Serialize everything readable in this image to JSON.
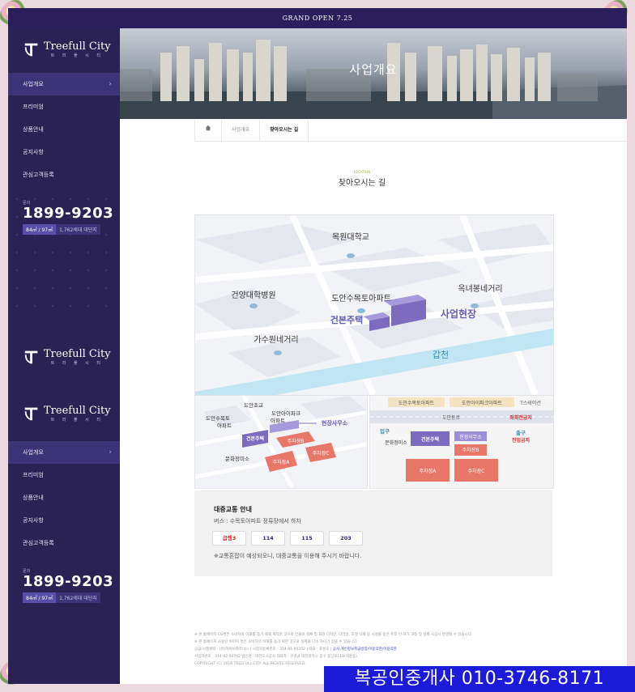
{
  "banner": {
    "text": "GRAND OPEN 7.25"
  },
  "logo": {
    "name": "Treefull City",
    "sub": "트 리 풀 시 티"
  },
  "nav": [
    {
      "label": "사업개요",
      "active": true
    },
    {
      "label": "프리미엄",
      "active": false
    },
    {
      "label": "상품안내",
      "active": false
    },
    {
      "label": "공지사항",
      "active": false
    },
    {
      "label": "관심고객등록",
      "active": false
    }
  ],
  "call": {
    "tag": "문의",
    "number": "1899-9203",
    "badge_size": "84㎡ / 97㎡",
    "badge_units": "1,762세대 대단지"
  },
  "hero": {
    "title": "사업개요"
  },
  "breadcrumb": {
    "home_icon": "home-icon",
    "level1": "사업개요",
    "current": "찾아오시는 길"
  },
  "section": {
    "tag": "LOCATION",
    "title": "찾아오시는 길"
  },
  "map_main": {
    "labels": {
      "university": "목원대학교",
      "hospital": "건양대학병원",
      "apartment": "도안수목토아파트",
      "okbong": "옥녀봉네거리",
      "site": "사업현장",
      "gunbon": "건본주택",
      "gasuwon": "가수원네거리",
      "river": "갑천"
    }
  },
  "map_left": {
    "labels": {
      "doan_school": "도안초교",
      "doan_sumoktow": "도안수목토",
      "apt1": "아파트",
      "doan_ipark": "도안아이파크",
      "apt2": "아파트",
      "field_office": "현장사무소",
      "gunbon": "건본주택",
      "parking_b": "주차장B",
      "munhwa": "문화정미소",
      "parking_a": "주차장A",
      "parking_c": "주차장C"
    }
  },
  "map_right": {
    "labels": {
      "top1": "도안수목토아파트",
      "top2": "도안아이파크아파트",
      "station": "T스테이션",
      "road": "도안동로",
      "left_turn": "좌회전금지",
      "entrance": "입구",
      "munhwa": "문화정미소",
      "gunbon": "건본주택",
      "field_office": "현장사무소",
      "parking_b": "주차장B",
      "exit": "출구",
      "no_entry": "진입금지",
      "parking_a": "주차장A",
      "parking_c": "주차장C"
    }
  },
  "transit": {
    "title": "대중교통 안내",
    "bus": "버스 : 수목토아파트 정류장에서 하차",
    "routes": [
      "급행3",
      "114",
      "115",
      "203"
    ],
    "note": "※교통혼잡이 예상되오니, 대중교통을 이용해 주시기 바랍니다."
  },
  "footer": {
    "line1": "※ 본 홈페이지 CG컷은 소비자의 이해를 돕기 위해 제작된 것으로 건물의 색채 및 외관 디자인, 다테일, 조경 식재 등 시설물 등은 추후 인·허가 과정 및 실제 시공시 변경될 수 있습니다.",
    "line2": "※ 본 홈페이지 사용된 이미지 컷은 소비자의 이해를 돕기 위한 것으로 실제와 다소 차이가 있을 수 있습니다.",
    "line3_prefix": "공급/시행위탁 : (유)하이브파트너스 | 시업자등록번호 : 314-81-95202 | 대표 : 조성호 | ",
    "line3_link": "공사 개인정보취급방침/이용약관/이용약관",
    "line4": "사업자번호 : 314-82-00702    법인명 : 대전도시공사    대표자 : 유영균    대전광역시 중구 중앙로118(대흥동)",
    "line5": "COPYRIGHT (C) 2018 TREEFULL CITY. ALL RIGHTS RESERVED."
  },
  "watermark": {
    "text": "복공인중개사 010-3746-8171"
  },
  "colors": {
    "sidebar": "#2a2255",
    "accent": "#5a4fa8",
    "route_red": "#d8262c",
    "watermark": "#1b1bd9"
  }
}
